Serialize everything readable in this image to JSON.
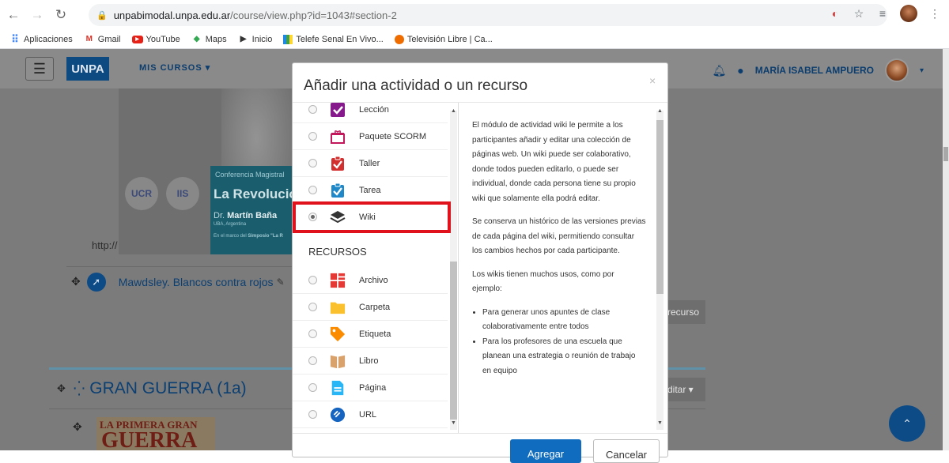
{
  "browser": {
    "url_host": "unpabimodal.unpa.edu.ar",
    "url_path": "/course/view.php?id=1043#section-2",
    "bookmarks": [
      "Aplicaciones",
      "Gmail",
      "YouTube",
      "Maps",
      "Inicio",
      "Telefe Senal En Vivo...",
      "Televisión Libre | Ca..."
    ]
  },
  "moodle_nav": {
    "brand": "UNPA",
    "mis_cursos": "MIS CURSOS ▾",
    "user_name": "MARÍA ISABEL AMPUERO"
  },
  "course": {
    "conference": {
      "logo_1": "UCR",
      "logo_2": "IIS",
      "kicker": "Conferencia Magistral",
      "title": "La Revolució",
      "speaker_prefix": "Dr.",
      "speaker_name": "Martín Baña",
      "affiliation": "UBA, Argentina",
      "note_prefix": "En el marco del",
      "note_bold": "Simposio \"La R"
    },
    "link_fragment": "http://",
    "activity_name": "Mawdsley. Blancos contra rojos",
    "add_resource_fragment": "recurso",
    "section_title": "GRAN GUERRA (1a)",
    "editar_fragment": "ditar ▾",
    "image2_top": "LA PRIMERA GRAN",
    "image2_big": "GUERRA"
  },
  "modal": {
    "title": "Añadir una actividad o un recurso",
    "close": "×",
    "activities": [
      {
        "label": "Lección",
        "icon": "lesson-icon",
        "selected": false
      },
      {
        "label": "Paquete SCORM",
        "icon": "scorm-icon",
        "selected": false
      },
      {
        "label": "Taller",
        "icon": "workshop-icon",
        "selected": false
      },
      {
        "label": "Tarea",
        "icon": "assignment-icon",
        "selected": false
      },
      {
        "label": "Wiki",
        "icon": "wiki-icon",
        "selected": true
      }
    ],
    "resources_heading": "RECURSOS",
    "resources": [
      {
        "label": "Archivo",
        "icon": "file-icon"
      },
      {
        "label": "Carpeta",
        "icon": "folder-icon"
      },
      {
        "label": "Etiqueta",
        "icon": "label-icon"
      },
      {
        "label": "Libro",
        "icon": "book-icon"
      },
      {
        "label": "Página",
        "icon": "page-icon"
      },
      {
        "label": "URL",
        "icon": "url-icon"
      }
    ],
    "description": {
      "p1": "El módulo de actividad wiki le permite a los participantes añadir y editar una colección de páginas web. Un wiki puede ser colaborativo, donde todos pueden editarlo, o puede ser individual, donde cada persona tiene su propio wiki que solamente ella podrá editar.",
      "p2": "Se conserva un histórico de las versiones previas de cada página del wiki, permitiendo consultar los cambios hechos por cada participante.",
      "p3": "Los wikis tienen muchos usos, como por ejemplo:",
      "bullets": [
        "Para generar unos apuntes de clase colaborativamente entre todos",
        "Para los profesores de una escuela que planean una estrategia o reunión de trabajo en equipo"
      ]
    },
    "add_button": "Agregar",
    "cancel_button": "Cancelar"
  },
  "colors": {
    "brand": "#0e4a82",
    "highlight": "#e0121b",
    "primary_button": "#0f6cbf"
  }
}
